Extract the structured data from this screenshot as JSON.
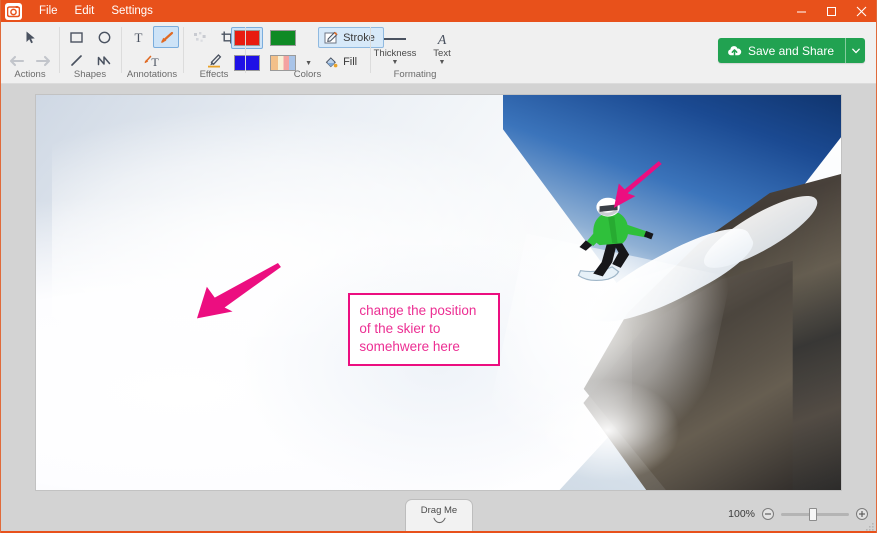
{
  "window": {
    "menu": [
      "File",
      "Edit",
      "Settings"
    ],
    "app_icon": "camera-icon",
    "controls": {
      "minimize": "minimize-icon",
      "maximize": "maximize-icon",
      "close": "close-icon"
    },
    "titlebar_color": "#e8511b"
  },
  "ribbon": {
    "groups": [
      {
        "label": "Actions",
        "items": [
          {
            "name": "select-tool",
            "icon": "cursor-arrow-icon",
            "selected": false
          },
          {
            "name": "undo-button",
            "icon": "undo-arrow-icon",
            "selected": false
          },
          {
            "name": "redo-button",
            "icon": "redo-arrow-icon",
            "selected": false
          }
        ]
      },
      {
        "label": "Shapes",
        "items": [
          {
            "name": "rectangle-tool",
            "icon": "rectangle-icon",
            "selected": false
          },
          {
            "name": "ellipse-tool",
            "icon": "ellipse-icon",
            "selected": false
          },
          {
            "name": "line-tool",
            "icon": "line-icon",
            "selected": false
          },
          {
            "name": "curve-tool",
            "icon": "squiggle-icon",
            "selected": false
          }
        ]
      },
      {
        "label": "Annotations",
        "items": [
          {
            "name": "text-tool",
            "icon": "text-t-icon",
            "selected": false
          },
          {
            "name": "arrow-tool",
            "icon": "arrow-pen-icon",
            "selected": true
          },
          {
            "name": "callout-tool",
            "icon": "arrow-text-icon",
            "selected": false
          }
        ]
      },
      {
        "label": "Effects",
        "items": [
          {
            "name": "blur-tool",
            "icon": "pixelate-icon",
            "selected": false
          },
          {
            "name": "crop-tool",
            "icon": "crop-icon",
            "selected": false
          },
          {
            "name": "highlighter-tool",
            "icon": "highlighter-pen-icon",
            "selected": false
          }
        ]
      }
    ],
    "colors": {
      "label": "Colors",
      "swatches": [
        {
          "name": "color-red",
          "hex": "#e81b10",
          "selected": true
        },
        {
          "name": "color-green",
          "hex": "#0f8a25",
          "selected": false
        },
        {
          "name": "color-blue",
          "hex": "#1f11e6",
          "selected": false
        },
        {
          "name": "color-gradient",
          "hex": "#f0b878",
          "selected": false,
          "has_dropdown": true
        }
      ],
      "stroke_label": "Stroke",
      "stroke_selected": true,
      "fill_label": "Fill",
      "fill_selected": false
    },
    "formatting": {
      "label": "Formating",
      "thickness_label": "Thickness",
      "text_label": "Text"
    },
    "save_and_share": {
      "label": "Save and Share",
      "icon": "cloud-upload-icon",
      "dropdown_icon": "chevron-down-icon",
      "color": "#21a251"
    }
  },
  "canvas": {
    "image_subject": "snowboarder-jumping-off-snowy-cliff",
    "annotations": {
      "accent_color": "#ec0e80",
      "arrows": [
        {
          "name": "annotation-arrow-top",
          "points_to": "snowboarder"
        },
        {
          "name": "annotation-arrow-callout",
          "points_to": "snow-slope"
        }
      ],
      "callout": {
        "name": "annotation-callout-box",
        "border_color": "#ec0e80",
        "text_color": "#ec2f93",
        "lines": [
          "change the position",
          "of the skier to",
          "somehwere here"
        ]
      }
    }
  },
  "statusbar": {
    "drag_handle": {
      "label": "Drag Me",
      "icon": "chevron-down-icon"
    },
    "zoom": {
      "percent": "100%",
      "zoom_out_icon": "minus-circle-icon",
      "zoom_in_icon": "plus-circle-icon",
      "slider_value": 100
    }
  }
}
